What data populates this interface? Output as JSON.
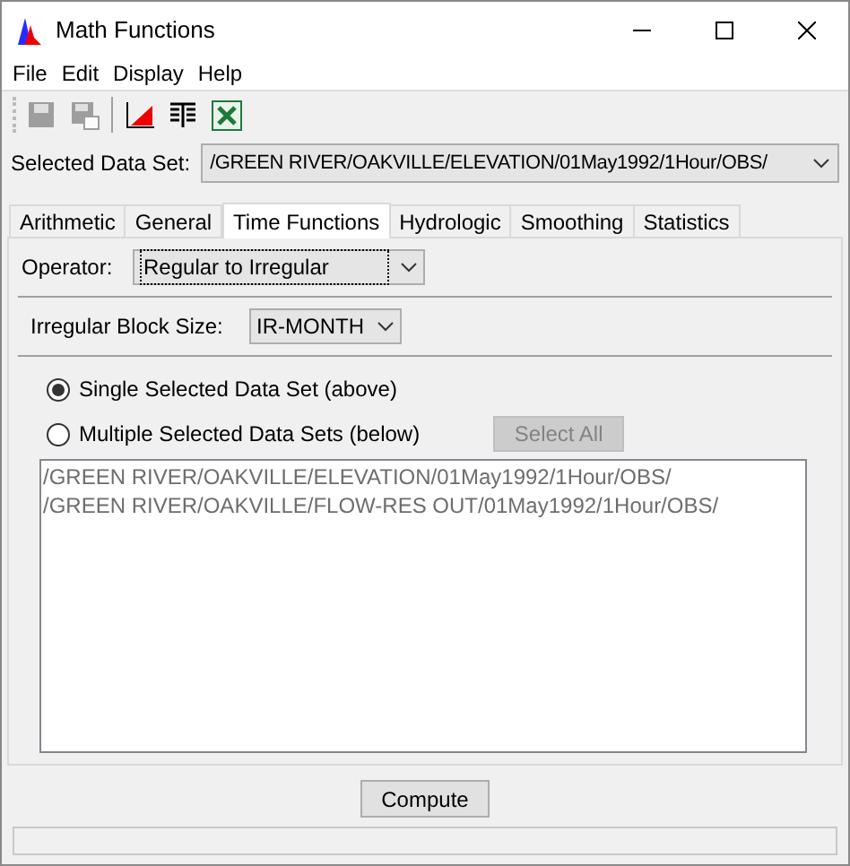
{
  "window": {
    "title": "Math Functions"
  },
  "menu": [
    "File",
    "Edit",
    "Display",
    "Help"
  ],
  "toolbar": [
    {
      "kind": "save",
      "disabled": true
    },
    {
      "kind": "save-as",
      "disabled": true
    },
    {
      "kind": "separator",
      "disabled": false
    },
    {
      "kind": "plot",
      "disabled": false
    },
    {
      "kind": "table",
      "disabled": false
    },
    {
      "kind": "excel",
      "disabled": false
    }
  ],
  "selected_data_set": {
    "label": "Selected Data Set:",
    "value": "/GREEN RIVER/OAKVILLE/ELEVATION/01May1992/1Hour/OBS/"
  },
  "tabs": [
    {
      "label": "Arithmetic",
      "selected": false
    },
    {
      "label": "General",
      "selected": false
    },
    {
      "label": "Time Functions",
      "selected": true
    },
    {
      "label": "Hydrologic",
      "selected": false
    },
    {
      "label": "Smoothing",
      "selected": false
    },
    {
      "label": "Statistics",
      "selected": false
    }
  ],
  "operator": {
    "label": "Operator:",
    "value": "Regular to Irregular"
  },
  "block_size": {
    "label": "Irregular Block Size:",
    "value": "IR-MONTH"
  },
  "radios": [
    {
      "label": "Single Selected Data Set (above)",
      "selected": true
    },
    {
      "label": "Multiple Selected Data Sets (below)",
      "selected": false
    }
  ],
  "select_all": {
    "label": "Select All",
    "disabled": true
  },
  "data_sets": [
    "/GREEN RIVER/OAKVILLE/ELEVATION/01May1992/1Hour/OBS/",
    "/GREEN RIVER/OAKVILLE/FLOW-RES OUT/01May1992/1Hour/OBS/"
  ],
  "compute": {
    "label": "Compute"
  }
}
